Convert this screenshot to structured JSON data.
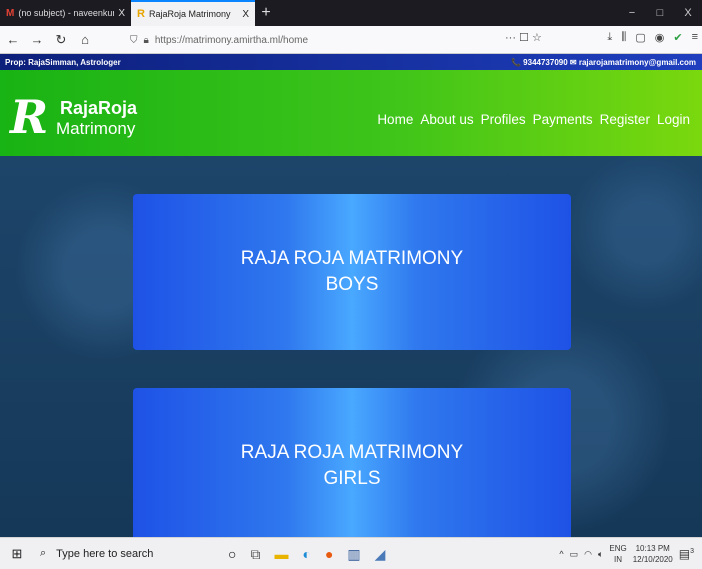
{
  "browser": {
    "tabs": [
      {
        "title": "(no subject) - naveenkumar.m",
        "icon": "gmail-icon",
        "close": "X"
      },
      {
        "title": "RajaRoja Matrimony",
        "icon": "rajaroja-icon",
        "close": "X"
      }
    ],
    "new_tab": "+",
    "window_controls": {
      "minimize": "−",
      "maximize": "□",
      "close": "X"
    },
    "url": "https://matrimony.amirtha.ml/home",
    "url_host_bold": "amirtha.ml",
    "page_actions": "··· ☐ ☆"
  },
  "topstrip": {
    "prop": "Prop: RajaSimman, Astrologer",
    "contact": "📞 9344737090 ✉ rajarojamatrimony@gmail.com"
  },
  "site": {
    "logo_letter": "R",
    "brand_name": "RajaRoja",
    "brand_sub": "Matrimony",
    "nav": [
      "Home",
      "About us",
      "Profiles",
      "Payments",
      "Register",
      "Login"
    ]
  },
  "cards": [
    {
      "line1": "RAJA ROJA MATRIMONY",
      "line2": "BOYS"
    },
    {
      "line1": "RAJA ROJA MATRIMONY",
      "line2": "GIRLS"
    }
  ],
  "taskbar": {
    "search_placeholder": "Type here to search",
    "lang_line1": "ENG",
    "lang_line2": "IN",
    "time": "10:13 PM",
    "date": "12/10/2020",
    "notification_count": "3"
  },
  "colors": {
    "header_green": "#3ec41a",
    "topstrip_blue": "#1f3fbf",
    "card_blue": "#2f78ee",
    "page_bg": "#1d456a"
  }
}
